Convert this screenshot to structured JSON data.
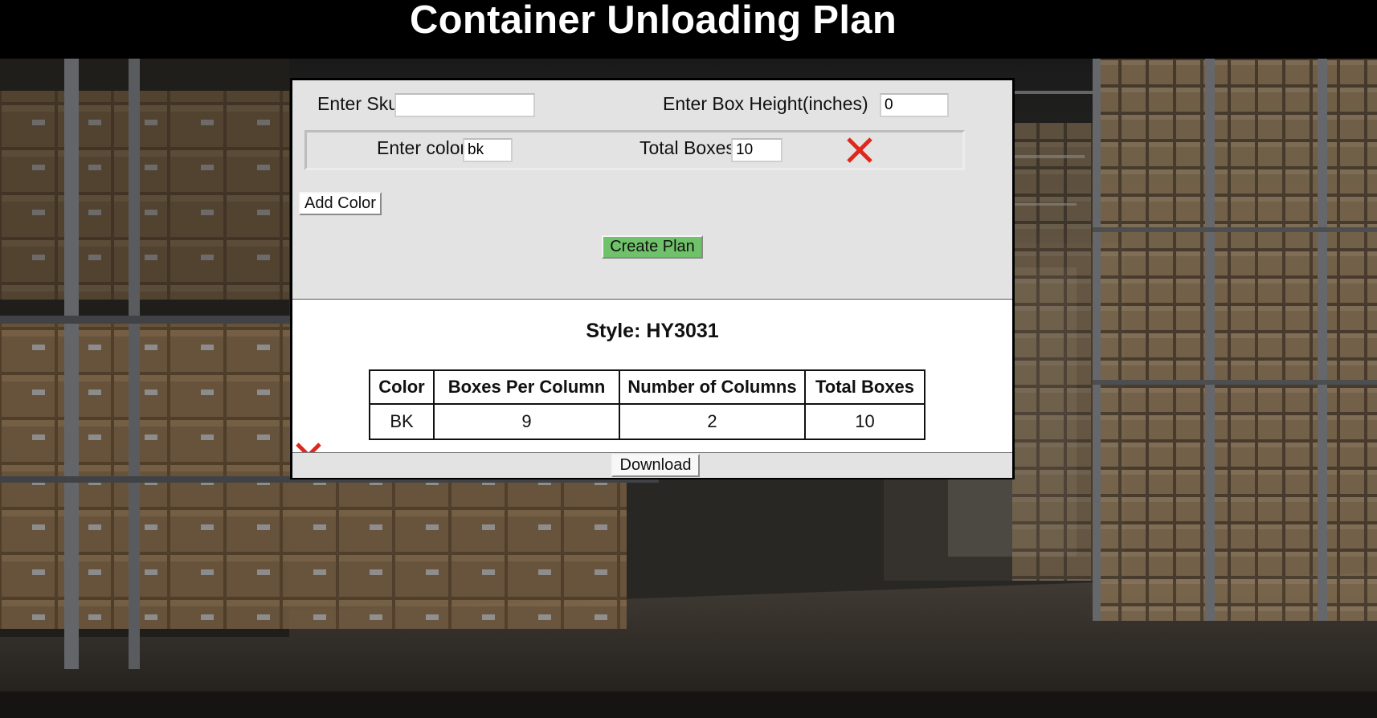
{
  "header": {
    "title": "Container Unloading Plan"
  },
  "form": {
    "sku_label": "Enter Sku",
    "sku_value": "",
    "box_height_label": "Enter Box Height(inches)",
    "box_height_value": "0",
    "color_row": {
      "color_label": "Enter color",
      "color_value": "bk",
      "total_boxes_label": "Total Boxes",
      "total_boxes_value": "10",
      "remove_icon": "red-x-icon"
    },
    "add_color_label": "Add Color",
    "create_plan_label": "Create Plan"
  },
  "result": {
    "style_title": "Style: HY3031",
    "columns": [
      "Color",
      "Boxes Per Column",
      "Number of Columns",
      "Total Boxes"
    ],
    "rows": [
      [
        "BK",
        "9",
        "2",
        "10"
      ]
    ],
    "remove_icon": "red-x-icon",
    "download_label": "Download"
  },
  "colors": {
    "header_bg": "#000000",
    "header_text": "#ffffff",
    "panel_bg": "#e3e3e3",
    "create_button": "#6fc26a",
    "remove_icon": "#e0271b"
  }
}
